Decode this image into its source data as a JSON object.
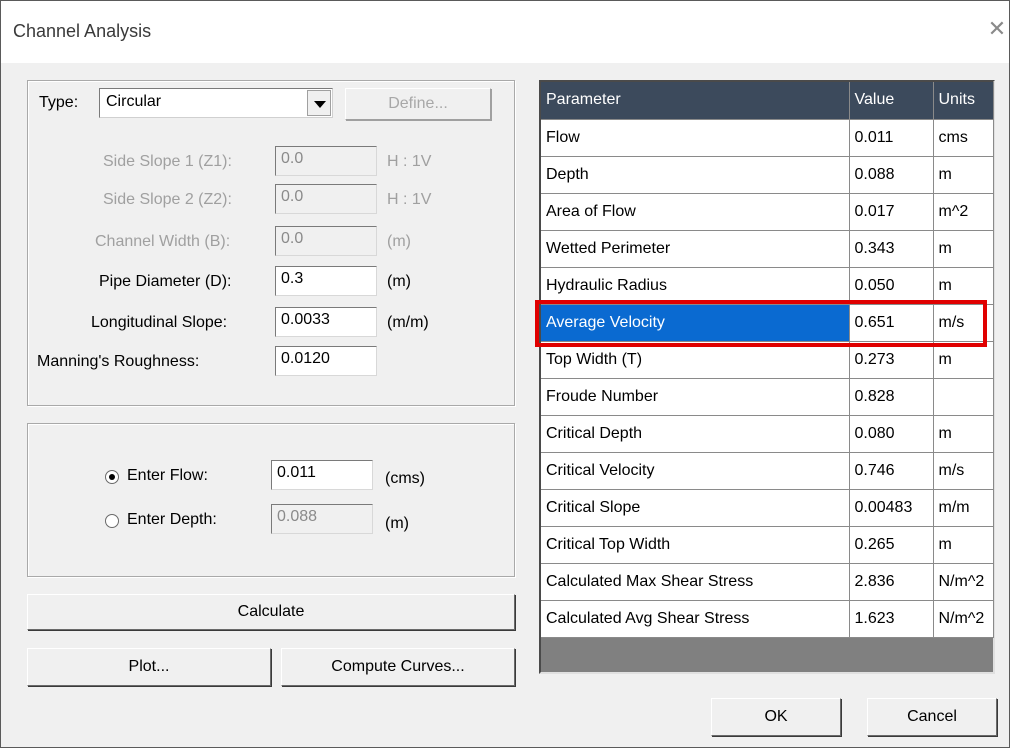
{
  "window": {
    "title": "Channel Analysis",
    "close_glyph": "✕"
  },
  "type_row": {
    "label": "Type:",
    "selected": "Circular",
    "define_button": "Define..."
  },
  "fields": [
    {
      "label": "Side Slope 1 (Z1):",
      "value": "0.0",
      "unit": "H : 1V",
      "enabled": false
    },
    {
      "label": "Side Slope 2 (Z2):",
      "value": "0.0",
      "unit": "H : 1V",
      "enabled": false
    },
    {
      "label": "Channel Width (B):",
      "value": "0.0",
      "unit": "(m)",
      "enabled": false
    },
    {
      "label": "Pipe Diameter (D):",
      "value": "0.3",
      "unit": "(m)",
      "enabled": true
    },
    {
      "label": "Longitudinal Slope:",
      "value": "0.0033",
      "unit": "(m/m)",
      "enabled": true
    },
    {
      "label": "Manning's Roughness:",
      "value": "0.0120",
      "unit": "",
      "enabled": true
    }
  ],
  "input_mode": {
    "flow": {
      "label": "Enter Flow:",
      "value": "0.011",
      "unit": "(cms)",
      "selected": true
    },
    "depth": {
      "label": "Enter Depth:",
      "value": "0.088",
      "unit": "(m)",
      "selected": false
    }
  },
  "buttons": {
    "calculate": "Calculate",
    "plot": "Plot...",
    "compute_curves": "Compute Curves...",
    "ok": "OK",
    "cancel": "Cancel"
  },
  "results": {
    "headers": [
      "Parameter",
      "Value",
      "Units"
    ],
    "rows": [
      [
        "Flow",
        "0.011",
        "cms"
      ],
      [
        "Depth",
        "0.088",
        "m"
      ],
      [
        "Area of Flow",
        "0.017",
        "m^2"
      ],
      [
        "Wetted Perimeter",
        "0.343",
        "m"
      ],
      [
        "Hydraulic Radius",
        "0.050",
        "m"
      ],
      [
        "Average Velocity",
        "0.651",
        "m/s"
      ],
      [
        "Top Width (T)",
        "0.273",
        "m"
      ],
      [
        "Froude Number",
        "0.828",
        ""
      ],
      [
        "Critical Depth",
        "0.080",
        "m"
      ],
      [
        "Critical Velocity",
        "0.746",
        "m/s"
      ],
      [
        "Critical Slope",
        "0.00483",
        "m/m"
      ],
      [
        "Critical Top Width",
        "0.265",
        "m"
      ],
      [
        "Calculated Max Shear Stress",
        "2.836",
        "N/m^2"
      ],
      [
        "Calculated Avg Shear Stress",
        "1.623",
        "N/m^2"
      ]
    ],
    "selected_row": 5,
    "highlight_color": "#e00000",
    "header_color": "#3c4a5c",
    "selection_color": "#0a6ad1"
  }
}
